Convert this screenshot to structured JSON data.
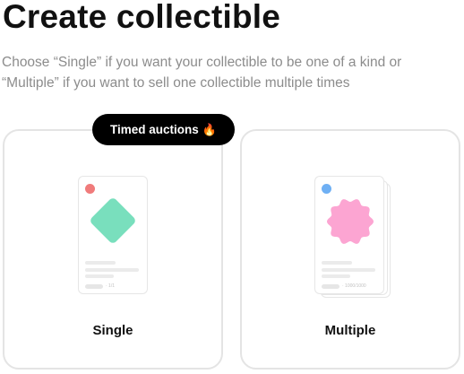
{
  "header": {
    "title": "Create collectible",
    "subtitle": "Choose “Single” if you want your collectible to be one of a kind or “Multiple” if you want to sell one collectible multiple times"
  },
  "options": {
    "single": {
      "label": "Single",
      "badge": "Timed auctions",
      "badge_icon": "fire-icon",
      "badge_emoji": "🔥",
      "edition_text": "· 1/1",
      "dot_color": "#f07b7b",
      "shape": "diamond",
      "shape_color": "#79dfbd"
    },
    "multiple": {
      "label": "Multiple",
      "edition_text": "· 1000/1000",
      "dot_color": "#6fb0f4",
      "shape": "flower",
      "shape_color": "#fca5d2"
    }
  },
  "colors": {
    "badge_background": "#000000",
    "card_border": "#e4e4e4",
    "subtitle": "#8c8c8c"
  }
}
